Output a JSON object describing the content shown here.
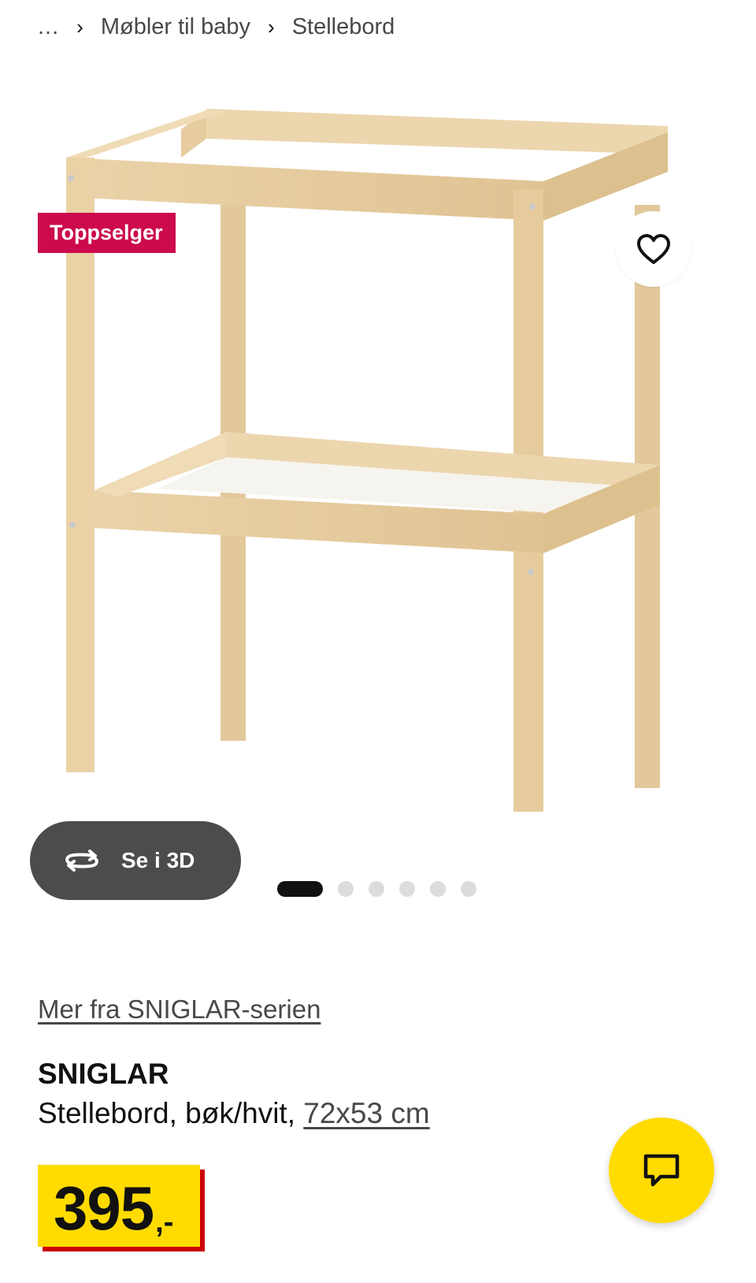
{
  "breadcrumb": {
    "ellipsis": "...",
    "items": [
      "Møbler til baby",
      "Stellebord"
    ],
    "separator": "›"
  },
  "media": {
    "badge": "Toppselger",
    "favorite_icon": "heart-outline-icon",
    "view3d_label": "Se i 3D",
    "view3d_icon": "rotate-arrows-icon",
    "image_count": 6,
    "active_image": 1
  },
  "product": {
    "series_link": "Mer fra SNIGLAR-serien",
    "name": "SNIGLAR",
    "description": "Stellebord, bøk/hvit, ",
    "size": "72x53 cm",
    "price_integer": "395",
    "price_suffix": ",-"
  },
  "chat": {
    "icon": "chat-bubble-icon"
  },
  "colors": {
    "badge": "#cc0a4d",
    "price_bg": "#ffdb00",
    "price_shadow": "#cc0008",
    "chat_bg": "#ffdb00",
    "wood": "#e8cfa4"
  }
}
